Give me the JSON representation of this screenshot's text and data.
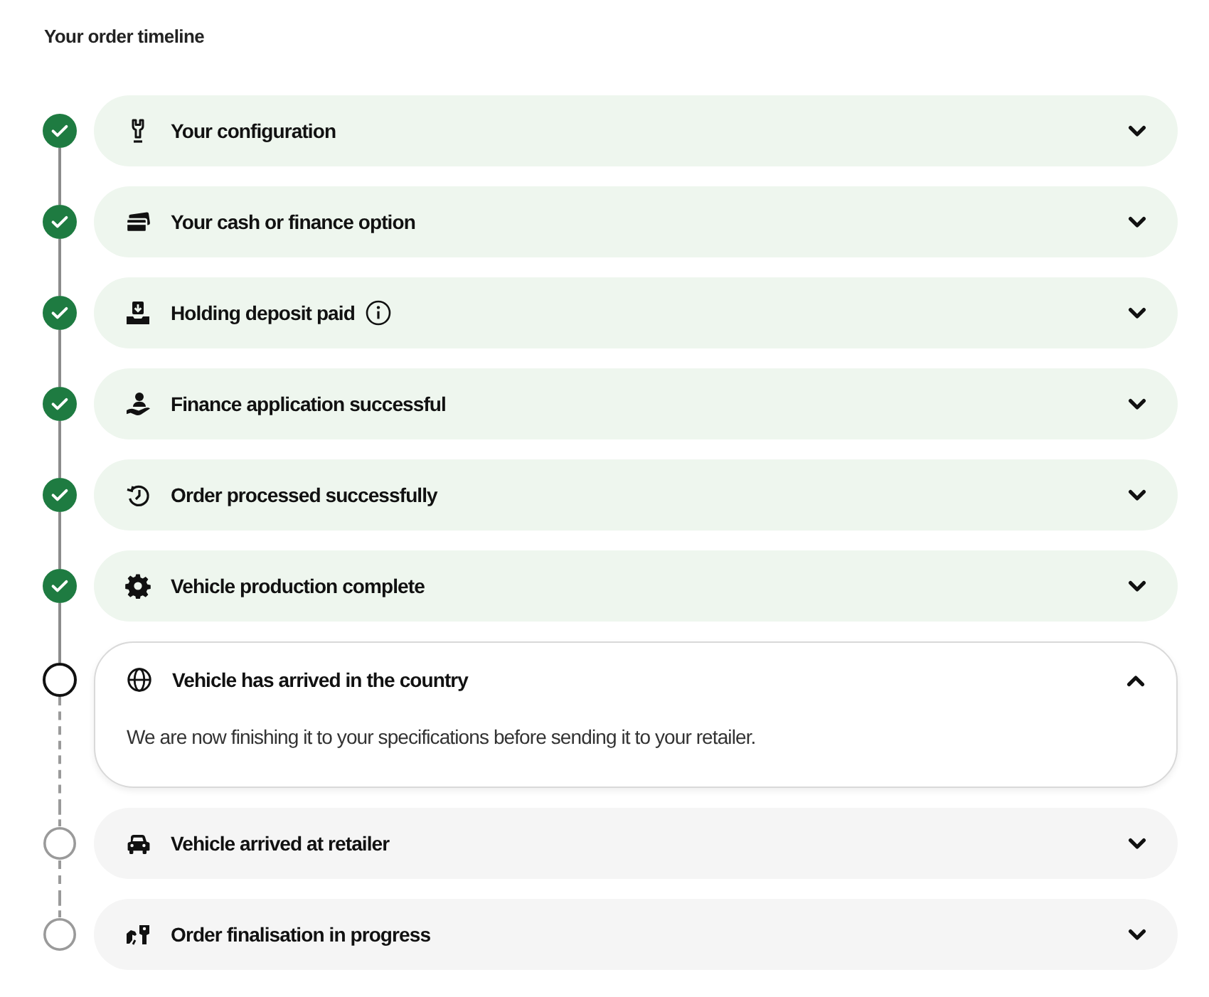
{
  "title": "Your order timeline",
  "steps": [
    {
      "label": "Your configuration",
      "completed": true,
      "current": false,
      "expanded": false,
      "info": false
    },
    {
      "label": "Your cash or finance option",
      "completed": true,
      "current": false,
      "expanded": false,
      "info": false
    },
    {
      "label": "Holding deposit paid",
      "completed": true,
      "current": false,
      "expanded": false,
      "info": true
    },
    {
      "label": "Finance application successful",
      "completed": true,
      "current": false,
      "expanded": false,
      "info": false
    },
    {
      "label": "Order processed successfully",
      "completed": true,
      "current": false,
      "expanded": false,
      "info": false
    },
    {
      "label": "Vehicle production complete",
      "completed": true,
      "current": false,
      "expanded": false,
      "info": false
    },
    {
      "label": "Vehicle has arrived in the country",
      "completed": false,
      "current": true,
      "expanded": true,
      "info": false,
      "description": "We are now finishing it to your specifications before sending it to your retailer."
    },
    {
      "label": "Vehicle arrived at retailer",
      "completed": false,
      "current": false,
      "expanded": false,
      "info": false
    },
    {
      "label": "Order finalisation in progress",
      "completed": false,
      "current": false,
      "expanded": false,
      "info": false
    }
  ]
}
